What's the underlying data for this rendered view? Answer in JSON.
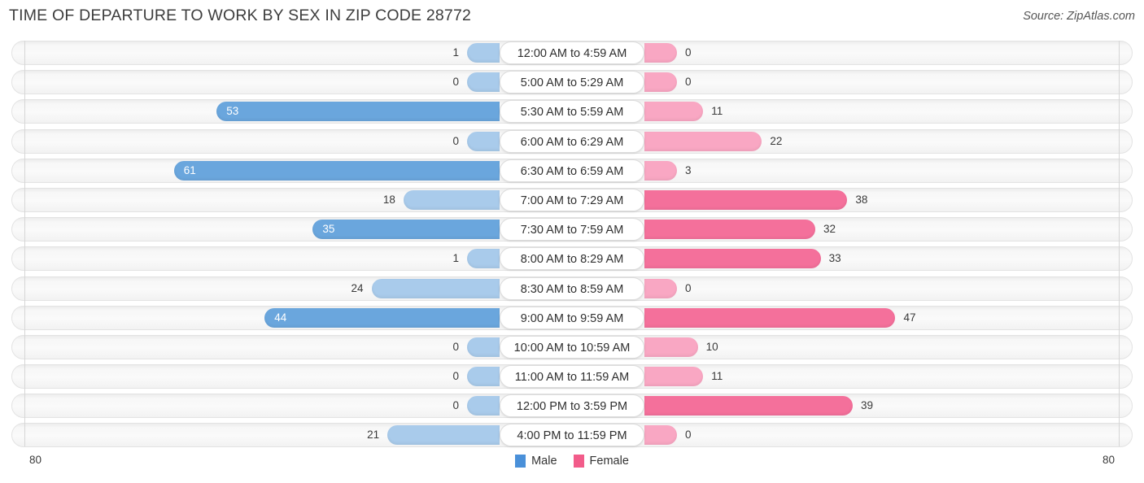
{
  "header": {
    "title": "TIME OF DEPARTURE TO WORK BY SEX IN ZIP CODE 28772",
    "source": "Source: ZipAtlas.com"
  },
  "legend": {
    "male_label": "Male",
    "female_label": "Female",
    "male_color": "#4a90d9",
    "female_color": "#f25c8a"
  },
  "axis": {
    "left_max": "80",
    "right_max": "80"
  },
  "colors": {
    "male_strong": "#6aa6dd",
    "male_light": "#a9cbeb",
    "female_strong": "#f4709b",
    "female_light": "#f9a7c3",
    "track": "#f7f7f7"
  },
  "chart_data": {
    "type": "bar",
    "orientation": "horizontal-diverging",
    "title": "TIME OF DEPARTURE TO WORK BY SEX IN ZIP CODE 28772",
    "xlabel": "",
    "ylabel": "",
    "xlim": [
      80,
      80
    ],
    "grid": false,
    "legend_position": "bottom-center",
    "categories": [
      "12:00 AM to 4:59 AM",
      "5:00 AM to 5:29 AM",
      "5:30 AM to 5:59 AM",
      "6:00 AM to 6:29 AM",
      "6:30 AM to 6:59 AM",
      "7:00 AM to 7:29 AM",
      "7:30 AM to 7:59 AM",
      "8:00 AM to 8:29 AM",
      "8:30 AM to 8:59 AM",
      "9:00 AM to 9:59 AM",
      "10:00 AM to 10:59 AM",
      "11:00 AM to 11:59 AM",
      "12:00 PM to 3:59 PM",
      "4:00 PM to 11:59 PM"
    ],
    "series": [
      {
        "name": "Male",
        "values": [
          1,
          0,
          53,
          0,
          61,
          18,
          35,
          1,
          24,
          44,
          0,
          0,
          0,
          21
        ]
      },
      {
        "name": "Female",
        "values": [
          0,
          0,
          11,
          22,
          3,
          38,
          32,
          33,
          0,
          47,
          10,
          11,
          39,
          0
        ]
      }
    ]
  }
}
